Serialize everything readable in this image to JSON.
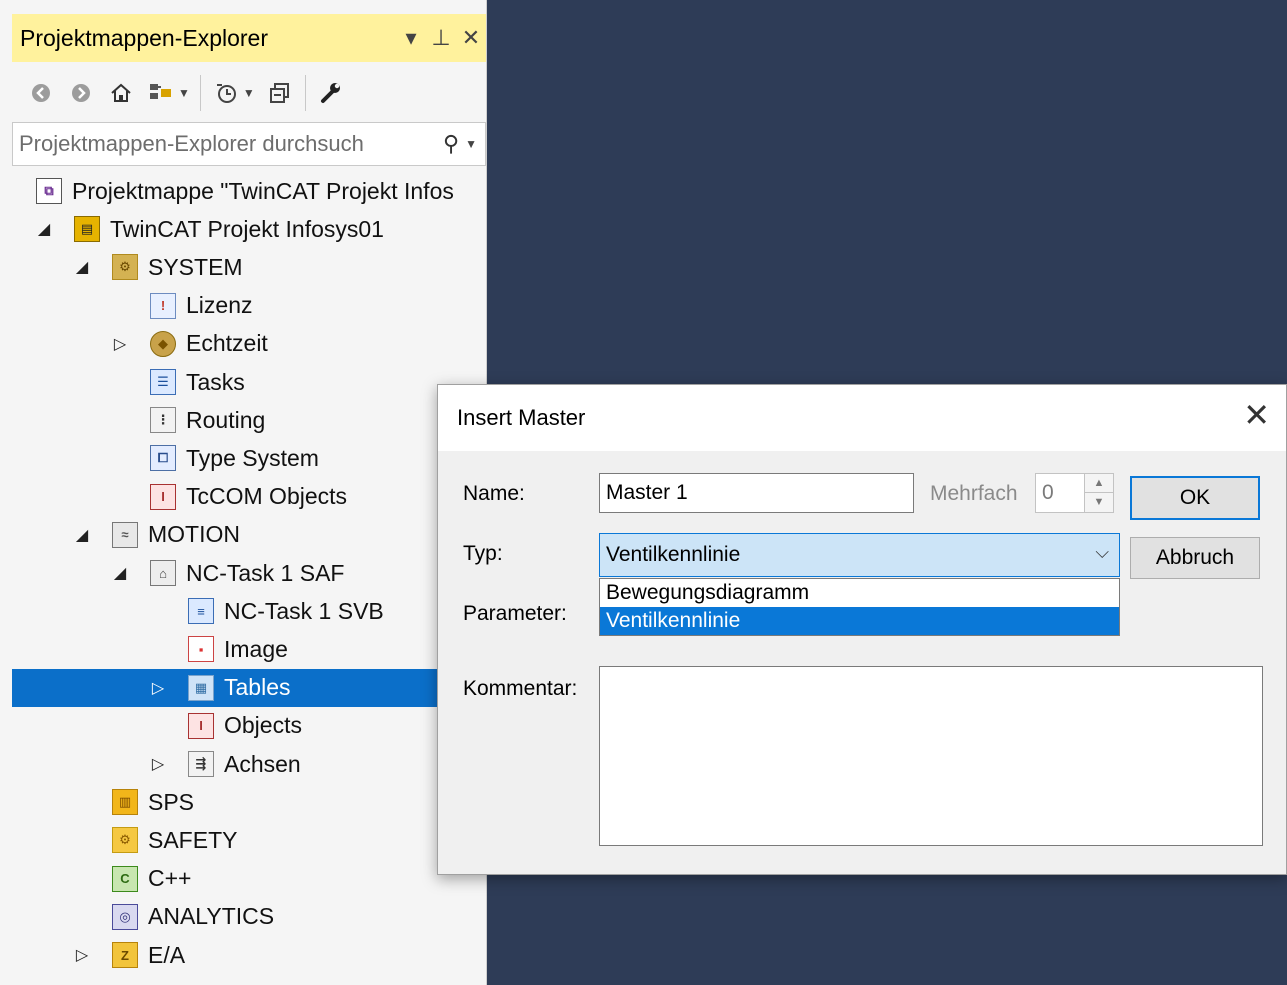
{
  "explorer": {
    "title": "Projektmappen-Explorer",
    "title_buttons": {
      "dropdown": "▾",
      "pin": "⊥",
      "close": "✕"
    },
    "search": {
      "placeholder": "Projektmappen-Explorer durchsuch"
    },
    "tree": [
      {
        "label": "Projektmappe \"TwinCAT Projekt Infos",
        "icon": "solution-icon",
        "expander": ""
      },
      {
        "label": "TwinCAT Projekt Infosys01",
        "icon": "twincat-project-icon",
        "expander": "◢"
      },
      {
        "label": "SYSTEM",
        "icon": "system-icon",
        "expander": "◢"
      },
      {
        "label": "Lizenz",
        "icon": "license-icon",
        "expander": ""
      },
      {
        "label": "Echtzeit",
        "icon": "realtime-icon",
        "expander": "▷"
      },
      {
        "label": "Tasks",
        "icon": "tasks-icon",
        "expander": ""
      },
      {
        "label": "Routing",
        "icon": "routing-icon",
        "expander": ""
      },
      {
        "label": "Type System",
        "icon": "type-system-icon",
        "expander": ""
      },
      {
        "label": "TcCOM Objects",
        "icon": "tccom-objects-icon",
        "expander": ""
      },
      {
        "label": "MOTION",
        "icon": "motion-icon",
        "expander": "◢"
      },
      {
        "label": "NC-Task 1 SAF",
        "icon": "nc-task-icon",
        "expander": "◢"
      },
      {
        "label": "NC-Task 1 SVB",
        "icon": "nc-task-svb-icon",
        "expander": ""
      },
      {
        "label": "Image",
        "icon": "image-icon",
        "expander": ""
      },
      {
        "label": "Tables",
        "icon": "tables-icon",
        "expander": "▷"
      },
      {
        "label": "Objects",
        "icon": "objects-icon",
        "expander": ""
      },
      {
        "label": "Achsen",
        "icon": "axes-icon",
        "expander": "▷"
      },
      {
        "label": "SPS",
        "icon": "sps-icon",
        "expander": ""
      },
      {
        "label": "SAFETY",
        "icon": "safety-icon",
        "expander": ""
      },
      {
        "label": "C++",
        "icon": "cpp-icon",
        "expander": ""
      },
      {
        "label": "ANALYTICS",
        "icon": "analytics-icon",
        "expander": ""
      },
      {
        "label": "E/A",
        "icon": "io-icon",
        "expander": "▷"
      }
    ]
  },
  "dialog": {
    "title": "Insert Master",
    "close_glyph": "✕",
    "name_label": "Name:",
    "name_value": "Master 1",
    "mehrfach_label": "Mehrfach",
    "mehrfach_value": "0",
    "typ_label": "Typ:",
    "typ_selected": "Ventilkennlinie",
    "typ_options": [
      "Bewegungsdiagramm",
      "Ventilkennlinie"
    ],
    "parameter_label": "Parameter:",
    "kommentar_label": "Kommentar:",
    "ok_label": "OK",
    "cancel_label": "Abbruch"
  }
}
